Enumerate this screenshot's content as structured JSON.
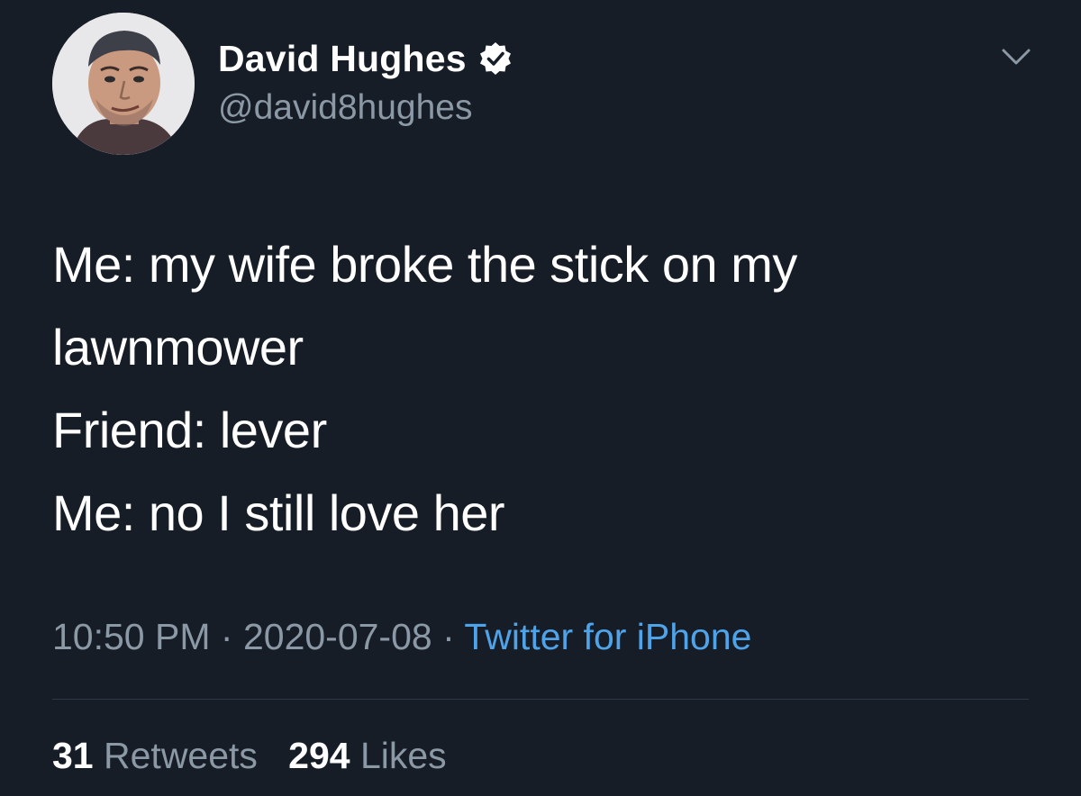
{
  "tweet": {
    "author": {
      "display_name": "David Hughes",
      "handle": "@david8hughes",
      "verified": true,
      "avatar_icon": "avatar-photo"
    },
    "menu_icon": "chevron-down-icon",
    "text_lines": [
      "Me: my wife broke the stick on my",
      "lawnmower",
      "Friend: lever",
      "Me: no I still love her"
    ],
    "meta": {
      "time": "10:50 PM",
      "separator": "·",
      "date": "2020-07-08",
      "source": "Twitter for iPhone"
    },
    "stats": {
      "retweets_count": "31",
      "retweets_label": "Retweets",
      "likes_count": "294",
      "likes_label": "Likes"
    },
    "colors": {
      "background": "#171d27",
      "text_primary": "#ffffff",
      "text_secondary": "#8b98a5",
      "link": "#4fa3e8",
      "verified_badge": "#ffffff"
    }
  }
}
